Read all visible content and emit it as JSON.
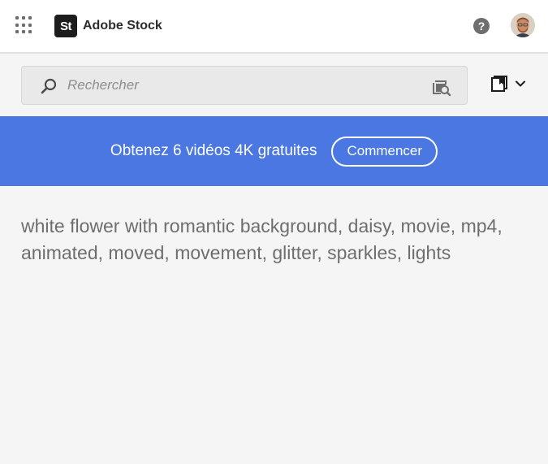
{
  "header": {
    "brand_logo": "St",
    "brand_name": "Adobe Stock",
    "help_label": "?",
    "icons": [
      "app-grid-icon",
      "help-icon",
      "avatar"
    ]
  },
  "search": {
    "placeholder": "Rechercher",
    "value": "",
    "icons": [
      "search-icon",
      "visual-search-icon",
      "library-icon",
      "chevron-down-icon"
    ]
  },
  "banner": {
    "text": "Obtenez 6 vidéos 4K gratuites",
    "button_label": "Commencer",
    "background": "#4a77e1"
  },
  "main": {
    "description": "white flower with romantic background, daisy, movie, mp4, animated, moved, movement, glitter, sparkles, lights"
  }
}
